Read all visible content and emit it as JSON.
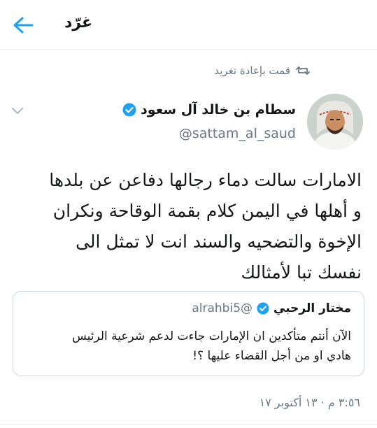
{
  "header": {
    "title": "غرّد"
  },
  "retweet": {
    "label": "قمت بإعادة تغريد"
  },
  "author": {
    "name": "سطام بن خالد آل سعود",
    "handle": "@sattam_al_saud"
  },
  "tweet": {
    "lines": [
      "الامارات سالت دماء رجالها دفاعن عن بلدها",
      "و أهلها في اليمن كلام بقمة الوقاحة ونكران",
      "الإخوة والتضحيه والسند انت لا تمثل الى",
      "نفسك تبا لأمثالك"
    ]
  },
  "quote": {
    "name": "مختار الرحبي",
    "handle": "@alrahbi5",
    "lines": [
      "الآن أنتم متأكدين ان الإمارات جاءت لدعم شرعية الرئيس",
      "هادي او من أجل القضاء عليها ؟!"
    ]
  },
  "timestamp": "٣:٥٦ م · ١٣ أكتوبر ١٧",
  "colors": {
    "accent": "#1da1f2",
    "muted": "#657786",
    "text": "#14171a",
    "verified": "#1da1f2"
  },
  "icons": {
    "back": "arrow-left-icon",
    "retweet": "retweet-icon",
    "verified": "verified-badge-icon",
    "caret": "chevron-down-icon"
  }
}
